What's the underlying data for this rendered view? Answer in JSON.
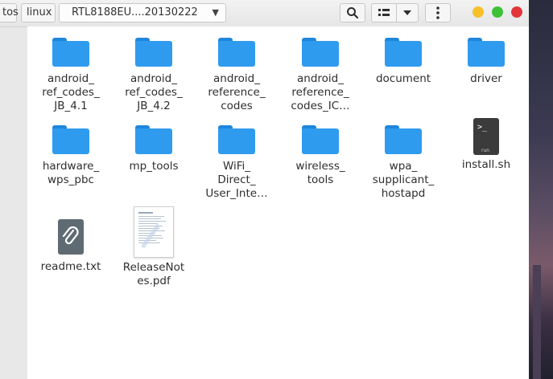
{
  "header": {
    "breadcrumbs": [
      "tos",
      "linux",
      "RTL8188EU....20130222"
    ],
    "icons": {
      "search": "search-icon",
      "view_list": "list-view-icon",
      "view_menu": "chevron-down-icon",
      "menu": "kebab-menu-icon"
    },
    "window_controls": {
      "minimize_color": "#f6c02b",
      "maximize_color": "#3fc137",
      "close_color": "#e2363b"
    }
  },
  "files": [
    {
      "name": "android_\nref_codes_\nJB_4.1",
      "type": "folder"
    },
    {
      "name": "android_\nref_codes_\nJB_4.2",
      "type": "folder"
    },
    {
      "name": "android_\nreference_\ncodes",
      "type": "folder"
    },
    {
      "name": "android_\nreference_\ncodes_IC…",
      "type": "folder"
    },
    {
      "name": "document",
      "type": "folder"
    },
    {
      "name": "driver",
      "type": "folder"
    },
    {
      "name": "hardware_\nwps_pbc",
      "type": "folder"
    },
    {
      "name": "mp_tools",
      "type": "folder"
    },
    {
      "name": "WiFi_\nDirect_\nUser_Inte…",
      "type": "folder"
    },
    {
      "name": "wireless_\ntools",
      "type": "folder"
    },
    {
      "name": "wpa_\nsupplicant_\nhostapd",
      "type": "folder"
    },
    {
      "name": "install.sh",
      "type": "script",
      "badge": "run",
      "prompt": ">_"
    },
    {
      "name": "readme.txt",
      "type": "text"
    },
    {
      "name": "ReleaseNot\nes.pdf",
      "type": "pdf"
    }
  ],
  "colors": {
    "folder": "#2f9bef",
    "folder_tab": "#1f86dc",
    "accent": "#e2363b"
  }
}
